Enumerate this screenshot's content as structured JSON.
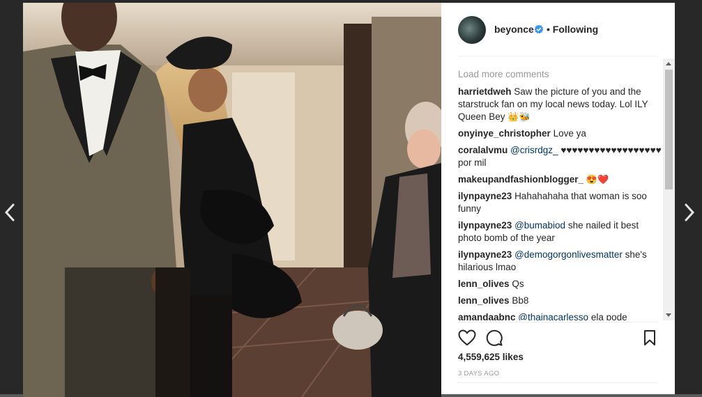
{
  "post": {
    "username": "beyonce",
    "separator": "•",
    "follow_label": "Following"
  },
  "comments": {
    "load_more": "Load more comments",
    "items": [
      {
        "user": "harrietdweh",
        "mention": "",
        "text": "Saw the picture of you and the starstruck fan on my local news today. Lol ILY Queen Bey",
        "emoji": "👑🐝"
      },
      {
        "user": "onyinye_christopher",
        "mention": "",
        "text": "Love ya",
        "emoji": ""
      },
      {
        "user": "coralalvmu",
        "mention": "@crisrdgz_",
        "text": "♥♥♥♥♥♥♥♥♥♥♥♥♥♥♥♥♥♥ por mil",
        "emoji": ""
      },
      {
        "user": "makeupandfashionblogger_",
        "mention": "",
        "text": "",
        "emoji": "😍❤️"
      },
      {
        "user": "ilynpayne23",
        "mention": "",
        "text": "Hahahahaha that woman is soo funny",
        "emoji": ""
      },
      {
        "user": "ilynpayne23",
        "mention": "@bumabiod",
        "text": "she nailed it best photo bomb of the year",
        "emoji": ""
      },
      {
        "user": "ilynpayne23",
        "mention": "@demogorgonlivesmatter",
        "text": "she's hilarious lmao",
        "emoji": ""
      },
      {
        "user": "lenn_olives",
        "mention": "",
        "text": "Qs",
        "emoji": ""
      },
      {
        "user": "lenn_olives",
        "mention": "",
        "text": "Bb8",
        "emoji": ""
      },
      {
        "user": "amandaabnc",
        "mention": "@thainacarlesso",
        "text": "ela pode",
        "emoji": ""
      }
    ]
  },
  "likes": "4,559,625 likes",
  "timestamp": "3 DAYS AGO",
  "icons": {
    "like": "heart-icon",
    "comment": "comment-bubble-icon",
    "save": "bookmark-icon",
    "prev": "chevron-left-icon",
    "next": "chevron-right-icon",
    "verified": "verified-badge-icon"
  },
  "colors": {
    "mention": "#003569",
    "verified": "#3897f0",
    "muted": "#999999",
    "text": "#262626"
  }
}
